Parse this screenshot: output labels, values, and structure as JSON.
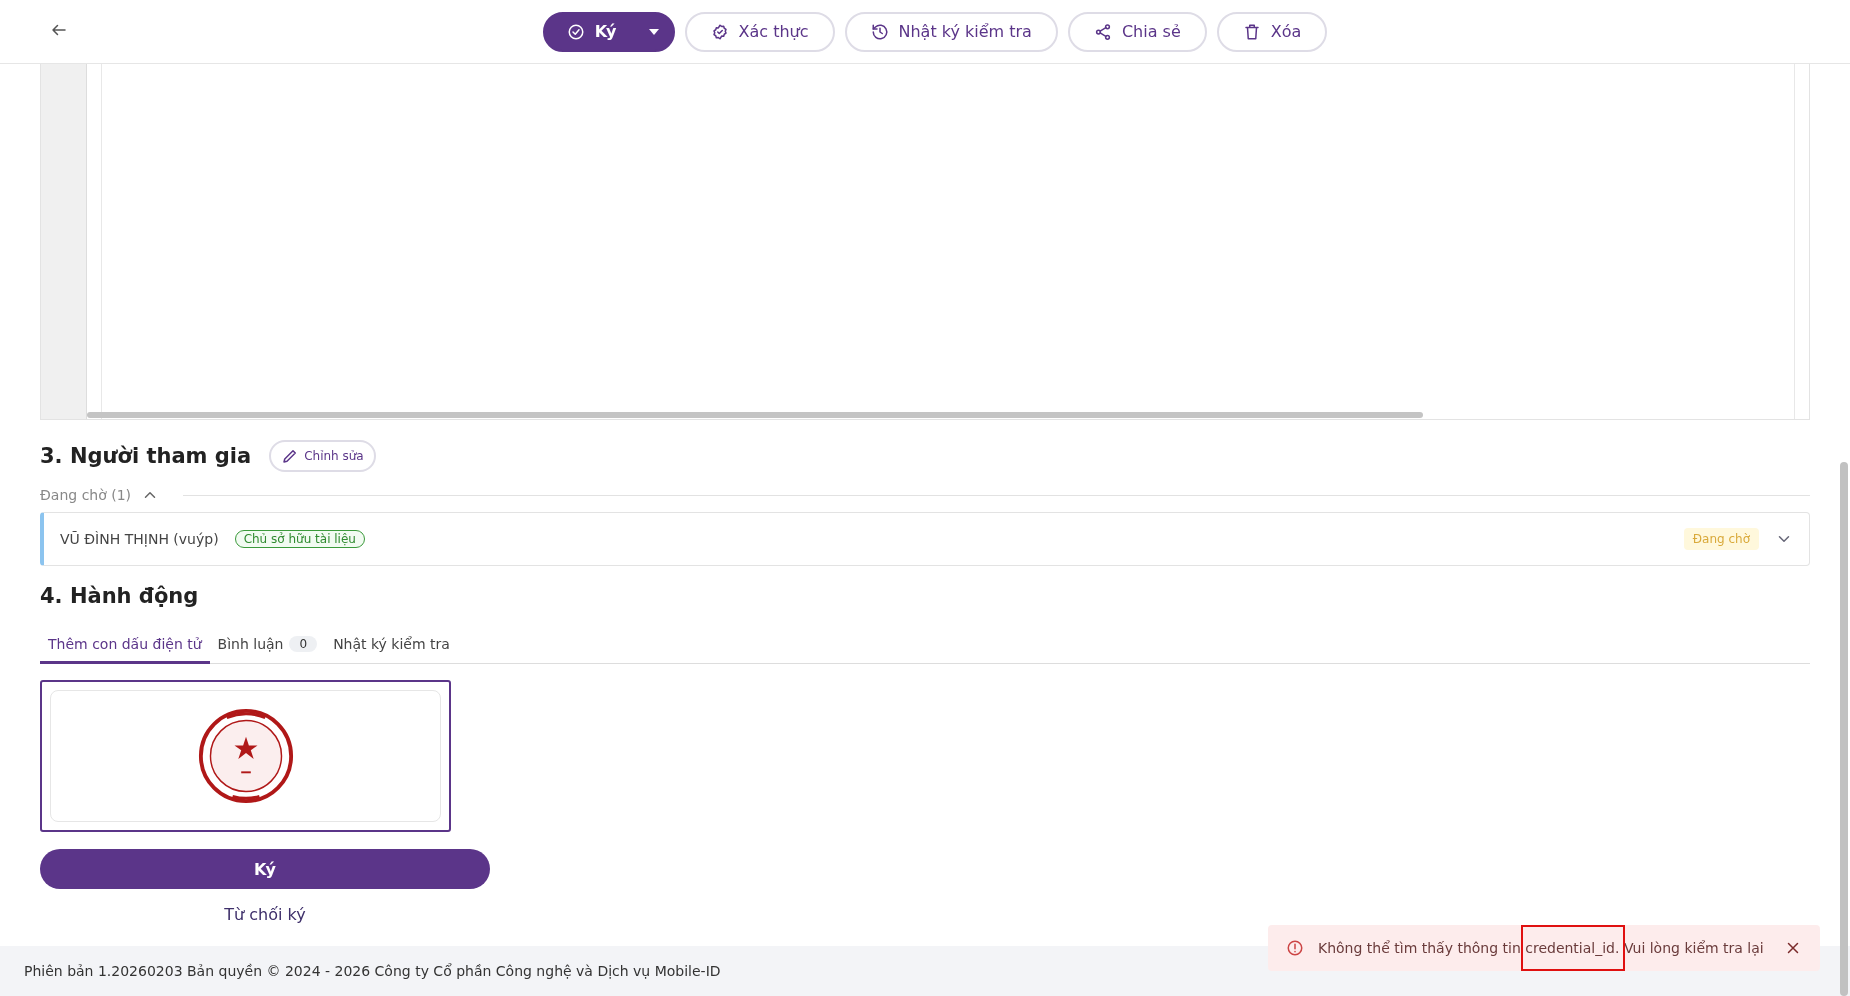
{
  "toolbar": {
    "buttons": [
      {
        "kind": "split",
        "label": "Ký"
      },
      {
        "kind": "outline",
        "label": "Xác thực"
      },
      {
        "kind": "outline",
        "label": "Nhật ký kiểm tra"
      },
      {
        "kind": "outline",
        "label": "Chia sẻ"
      },
      {
        "kind": "outline",
        "label": "Xóa"
      }
    ]
  },
  "participants_section": {
    "title": "3. Người tham gia",
    "edit_button": "Chỉnh sửa",
    "group": {
      "label": "Đang chờ (1)",
      "expanded": true
    },
    "participants": [
      {
        "name": "VŨ ĐÌNH THỊNH (vuýp)",
        "role": "Chủ sở hữu tài liệu",
        "status": "Đang chờ"
      }
    ]
  },
  "action_section": {
    "title": "4. Hành động",
    "tabs": [
      {
        "label": "Thêm con dấu điện tử",
        "selected": true
      },
      {
        "label": "Bình luận",
        "count": "0",
        "selected": false
      },
      {
        "label": "Nhật ký kiểm tra",
        "selected": false
      }
    ],
    "stamps": [
      {
        "kind": "picture",
        "selected": true
      }
    ],
    "sign_button": "Ký",
    "decline_link": "Từ chối ký"
  },
  "footer": {
    "text": "Phiên bản 1.20260203 Bản quyền © 2024 - 2026 Công ty Cổ phần Công nghệ và Dịch vụ Mobile-ID"
  },
  "toast": {
    "message": "Không thể tìm thấy thông tin credential_id. Vui lòng kiểm tra lại"
  }
}
